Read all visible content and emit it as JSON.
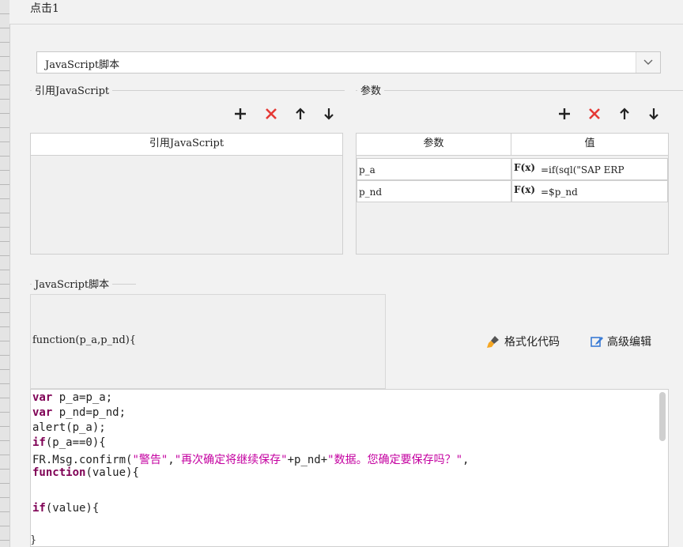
{
  "dialog": {
    "title": "点击1"
  },
  "script_type": {
    "value": "JavaScript脚本"
  },
  "ref_js": {
    "label": "引用JavaScript",
    "column_header": "引用JavaScript"
  },
  "params": {
    "label": "参数",
    "col_param": "参数",
    "col_value": "值",
    "rows": [
      {
        "name": "p_a",
        "fx": "F(x)",
        "value": "=if(sql(\"SAP ERP"
      },
      {
        "name": "p_nd",
        "fx": "F(x)",
        "value": "=$p_nd"
      }
    ]
  },
  "js_script": {
    "label": "JavaScript脚本",
    "signature": "function(p_a,p_nd){",
    "format_label": "格式化代码",
    "advanced_label": "高级编辑",
    "closing_brace": "}"
  },
  "code_lines": [
    {
      "kw": "var",
      "rest": " p_a=p_a;"
    },
    {
      "kw": "var",
      "rest": " p_nd=p_nd;"
    },
    {
      "kw": "",
      "rest": "alert(p_a);"
    },
    {
      "kw": "if",
      "rest": "(p_a==0){"
    },
    {
      "kw": "",
      "rest": "FR.Msg.confirm(\"警告\",\"再次确定将继续保存\"+p_nd+\"数据。您确定要保存吗？\","
    },
    {
      "kw": "function",
      "rest": "(value){"
    },
    {
      "kw": "",
      "rest": ""
    },
    {
      "kw": "if",
      "rest": "(value){"
    }
  ],
  "colors": {
    "delete": "#e53935",
    "keyword": "#7f0055",
    "string": "#c400a0"
  },
  "icons": [
    "plus-icon",
    "delete-x-icon",
    "arrow-up-icon",
    "arrow-down-icon",
    "chevron-down-icon",
    "brush-icon",
    "edit-icon"
  ]
}
